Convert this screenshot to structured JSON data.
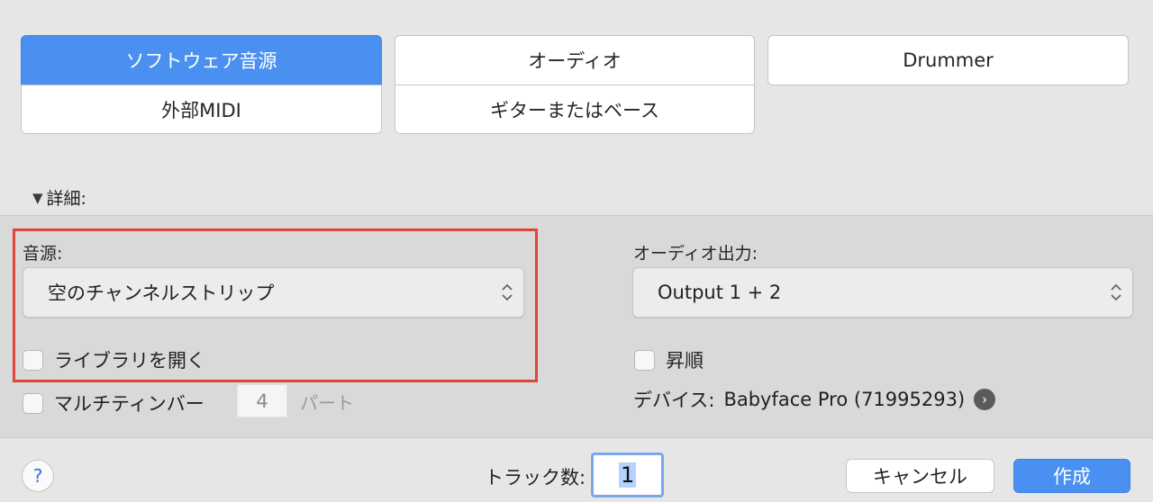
{
  "track_types": {
    "software_instrument": "ソフトウェア音源",
    "external_midi": "外部MIDI",
    "audio": "オーディオ",
    "guitar_bass": "ギターまたはベース",
    "drummer": "Drummer"
  },
  "details": {
    "toggle_label": "詳細:",
    "instrument_label": "音源:",
    "instrument_value": "空のチャンネルストリップ",
    "open_library_label": "ライブラリを開く",
    "multitimbral_label": "マルチティンバー",
    "multitimbral_parts": "4",
    "parts_unit": "パート",
    "audio_output_label": "オーディオ出力:",
    "audio_output_value": "Output 1 + 2",
    "ascending_label": "昇順",
    "device_label": "デバイス:",
    "device_value": "Babyface Pro (71995293)"
  },
  "footer": {
    "help": "?",
    "tracks_label": "トラック数:",
    "tracks_value": "1",
    "cancel_label": "キャンセル",
    "create_label": "作成"
  },
  "colors": {
    "accent": "#4a90f0",
    "highlight": "#e0453a"
  },
  "icons": {
    "details_toggle": "disclosure-triangle-down-icon",
    "popup_arrows": "up-down-chevrons-icon",
    "device_go": "arrow-right-circle-icon",
    "help": "help-icon"
  }
}
